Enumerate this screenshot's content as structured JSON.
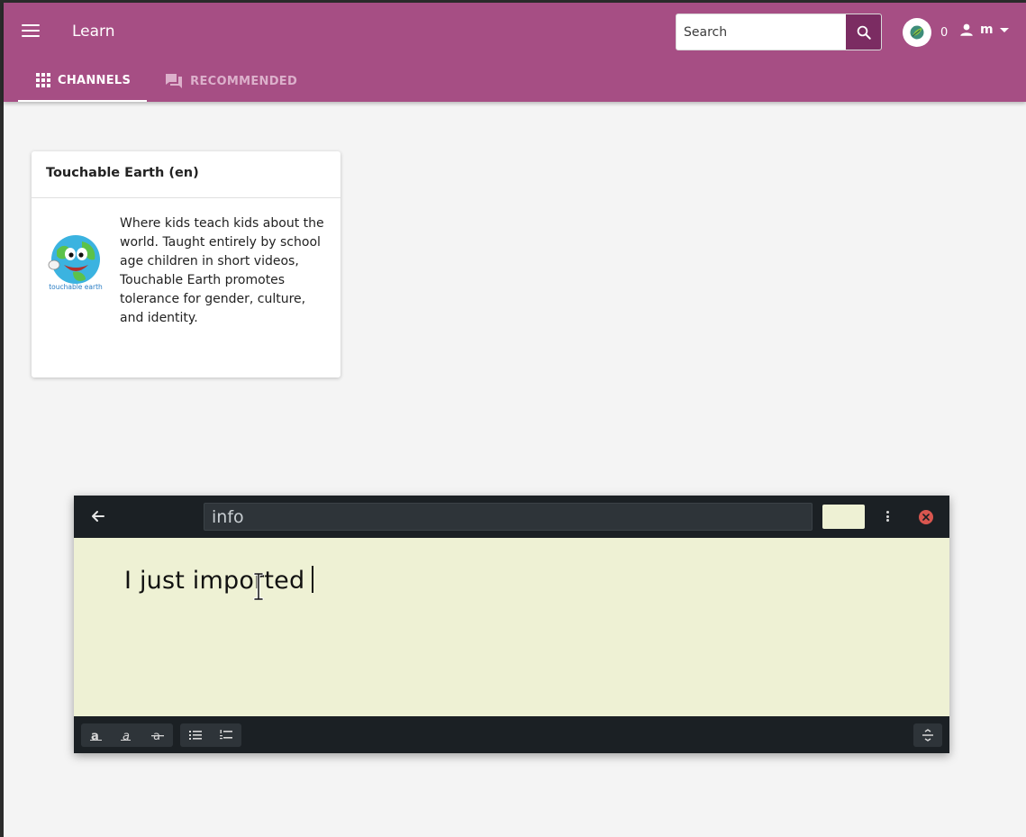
{
  "app": {
    "title": "Learn"
  },
  "search": {
    "placeholder": "Search"
  },
  "points": {
    "count": "0"
  },
  "user": {
    "label": "m"
  },
  "tabs": [
    {
      "label": "CHANNELS",
      "icon": "grid-icon",
      "active": true
    },
    {
      "label": "RECOMMENDED",
      "icon": "forum-icon",
      "active": false
    }
  ],
  "channel_card": {
    "title": "Touchable Earth (en)",
    "description": "Where kids teach kids about the world. Taught entirely by school age children in short videos, Touchable Earth promotes tolerance for gender, culture, and identity.",
    "logo_text": "touchable earth"
  },
  "note_window": {
    "title_value": "info",
    "body_text": "I just imported",
    "swatch_color": "#eef1d4",
    "format_buttons": [
      "bold",
      "italic",
      "strikethrough",
      "bullet-list",
      "numbered-list"
    ]
  },
  "colors": {
    "appbar": "#a64e84",
    "search_button": "#7b2c62",
    "note_background": "#eef1d4",
    "note_chrome": "#1b2024",
    "close": "#d9564f"
  }
}
